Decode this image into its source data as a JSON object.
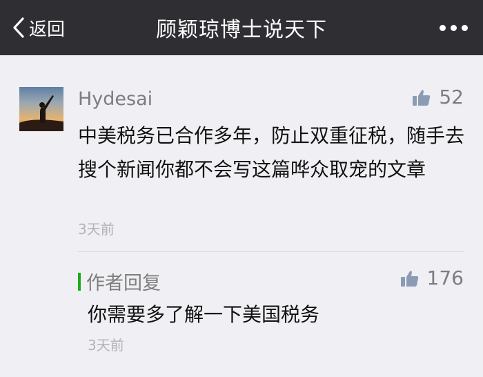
{
  "header": {
    "back_label": "返回",
    "title": "顾颖琼博士说天下",
    "more_icon": "more-dots-icon"
  },
  "comment": {
    "username": "Hydesai",
    "likes": "52",
    "text": "中美税务已合作多年，防止双重征税，随手去搜个新闻你都不会写这篇哗众取宠的文章",
    "time": "3天前"
  },
  "reply": {
    "label": "作者回复",
    "likes": "176",
    "text": "你需要多了解一下美国税务",
    "time": "3天前"
  },
  "colors": {
    "topbar": "#2e2e33",
    "background": "#efeff4",
    "accent_green": "#1aad19",
    "muted_text": "#7d7d7d"
  }
}
